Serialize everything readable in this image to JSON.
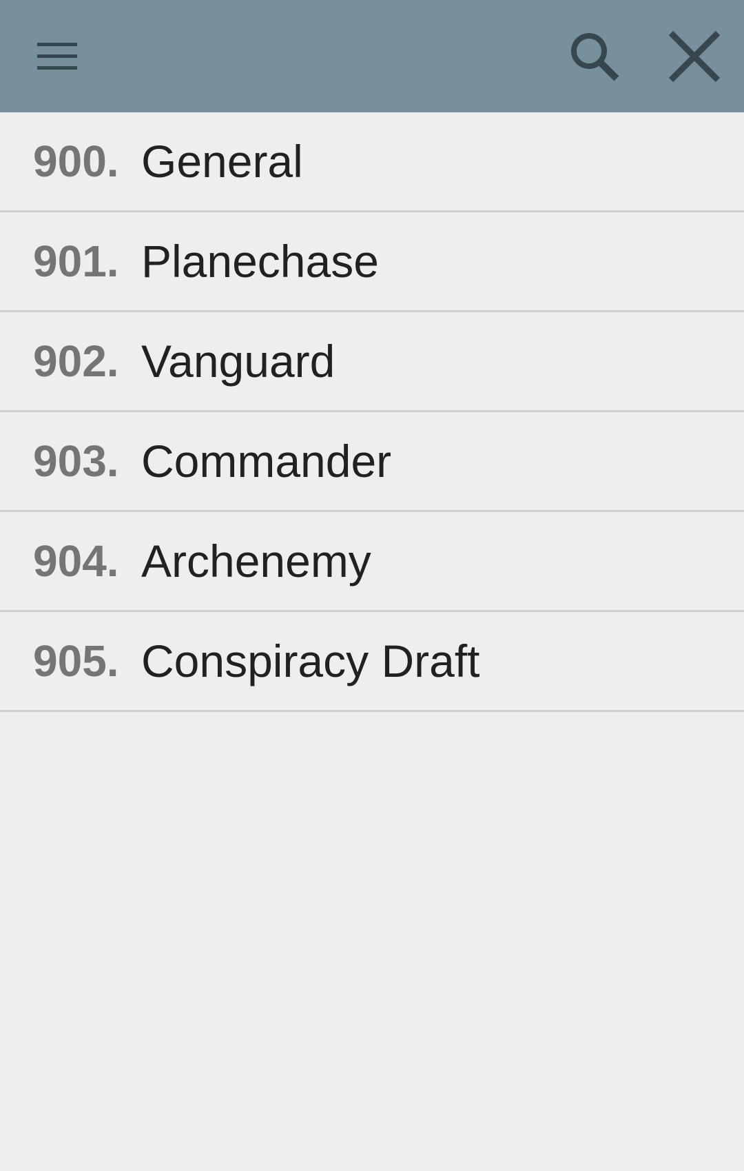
{
  "toolbar": {
    "menu_icon": "hamburger-menu-icon",
    "search_icon": "search-icon",
    "close_icon": "close-icon",
    "background": "#78909c",
    "icon_color": "#37474f"
  },
  "list": {
    "items": [
      {
        "number": "900.",
        "label": "General"
      },
      {
        "number": "901.",
        "label": "Planechase"
      },
      {
        "number": "902.",
        "label": "Vanguard"
      },
      {
        "number": "903.",
        "label": "Commander"
      },
      {
        "number": "904.",
        "label": "Archenemy"
      },
      {
        "number": "905.",
        "label": "Conspiracy Draft"
      }
    ]
  }
}
